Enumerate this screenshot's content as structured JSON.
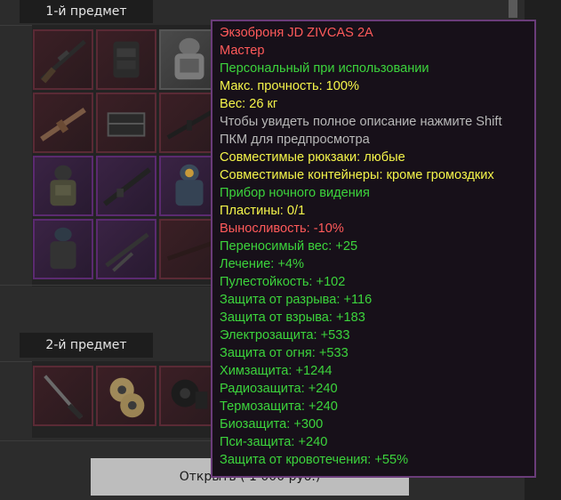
{
  "sections": {
    "first": "1-й предмет",
    "second": "2-й предмет"
  },
  "open_button": "Открыть ( 1 000 руб.)",
  "tooltip": {
    "lines": [
      {
        "text": "Экзоброня JD ZIVCAS 2A",
        "color": "red"
      },
      {
        "text": "Мастер",
        "color": "red"
      },
      {
        "text": "Персональный при использовании",
        "color": "green"
      },
      {
        "text": "Макс. прочность: 100%",
        "color": "yellow"
      },
      {
        "text": "Вес: 26 кг",
        "color": "yellow"
      },
      {
        "text": "Чтобы увидеть полное описание нажмите Shift",
        "color": "gray"
      },
      {
        "text": "ПКМ для предпросмотра",
        "color": "gray"
      },
      {
        "text": "Совместимые рюкзаки: любые",
        "color": "yellow"
      },
      {
        "text": "Совместимые контейнеры: кроме громоздких",
        "color": "yellow"
      },
      {
        "text": "Прибор ночного видения",
        "color": "green"
      },
      {
        "text": "Пластины: 0/1",
        "color": "yellow"
      },
      {
        "text": "Выносливость: -10%",
        "color": "red"
      },
      {
        "text": "Переносимый вес: +25",
        "color": "green"
      },
      {
        "text": "Лечение: +4%",
        "color": "green"
      },
      {
        "text": "Пулестойкость: +102",
        "color": "green"
      },
      {
        "text": "Защита от разрыва: +116",
        "color": "green"
      },
      {
        "text": "Защита от взрыва: +183",
        "color": "green"
      },
      {
        "text": "Электрозащита: +533",
        "color": "green"
      },
      {
        "text": "Защита от огня: +533",
        "color": "green"
      },
      {
        "text": "Химзащита: +1244",
        "color": "green"
      },
      {
        "text": "Радиозащита: +240",
        "color": "green"
      },
      {
        "text": "Термозащита: +240",
        "color": "green"
      },
      {
        "text": "Биозащита: +300",
        "color": "green"
      },
      {
        "text": "Пси-защита: +240",
        "color": "green"
      },
      {
        "text": "Защита от кровотечения: +55%",
        "color": "green"
      }
    ]
  },
  "grid1_items": [
    {
      "icon": "sniper-rifle-icon",
      "rarity": "red"
    },
    {
      "icon": "armor-vest-icon",
      "rarity": "red"
    },
    {
      "icon": "exoskeleton-icon",
      "rarity": "gray"
    },
    {
      "icon": "assault-rifle-icon",
      "rarity": "red"
    },
    {
      "icon": "ammo-crate-icon",
      "rarity": "red"
    },
    {
      "icon": "rifle-icon",
      "rarity": "red"
    },
    {
      "icon": "combat-suit-icon",
      "rarity": "purple"
    },
    {
      "icon": "machine-gun-icon",
      "rarity": "purple"
    },
    {
      "icon": "hazmat-suit-icon",
      "rarity": "purple"
    },
    {
      "icon": "tactical-vest-icon",
      "rarity": "purple"
    },
    {
      "icon": "grenade-launcher-icon",
      "rarity": "purple"
    },
    {
      "icon": "shotgun-icon",
      "rarity": "red"
    }
  ],
  "grid2_items": [
    {
      "icon": "bayonet-icon",
      "rarity": "red"
    },
    {
      "icon": "tape-roll-icon",
      "rarity": "red"
    },
    {
      "icon": "drum-magazine-icon",
      "rarity": "red"
    }
  ]
}
